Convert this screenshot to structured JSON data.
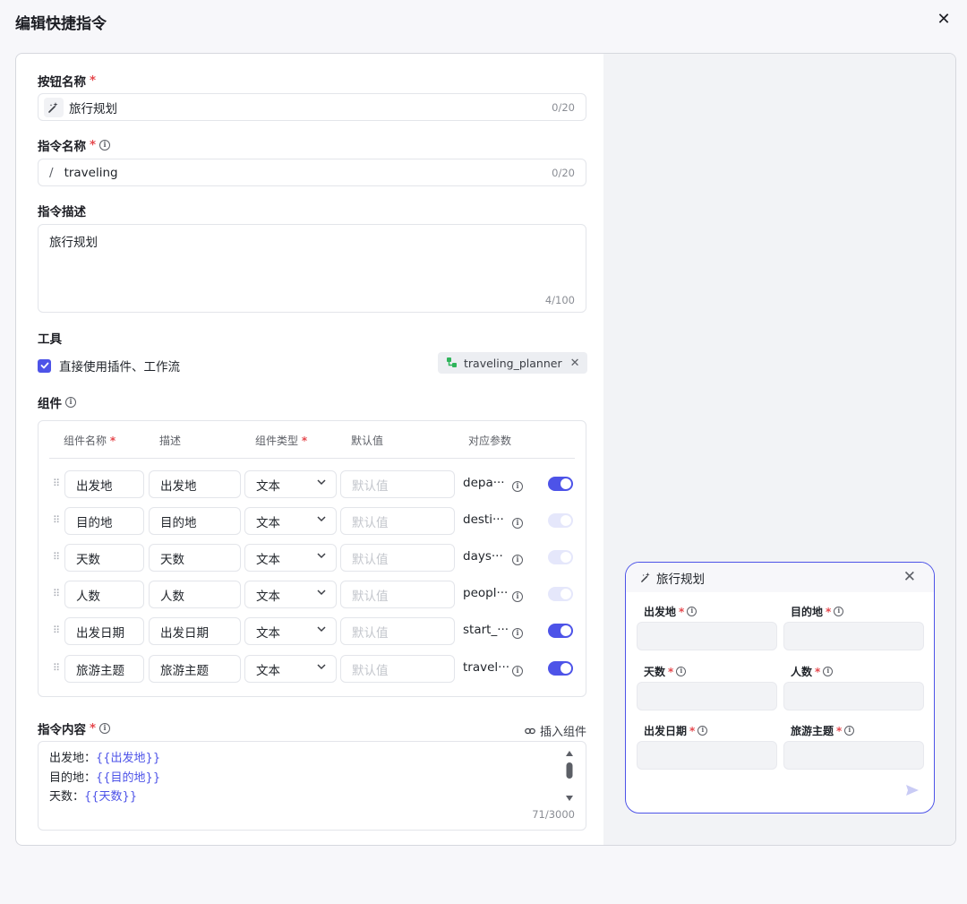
{
  "dialog": {
    "title": "编辑快捷指令"
  },
  "button_name": {
    "label": "按钮名称",
    "required": "*",
    "value": "旅行规划",
    "counter": "0/20"
  },
  "command_name": {
    "label": "指令名称",
    "required": "*",
    "prefix": "/",
    "value": "traveling",
    "counter": "0/20"
  },
  "command_desc": {
    "label": "指令描述",
    "value": "旅行规划",
    "counter": "4/100"
  },
  "tools": {
    "label": "工具",
    "checkbox_label": "直接使用插件、工作流",
    "checked": true,
    "tag": "traveling_planner"
  },
  "components": {
    "label": "组件",
    "headers": {
      "name": "组件名称",
      "desc": "描述",
      "type": "组件类型",
      "default": "默认值",
      "param": "对应参数",
      "required": "*"
    },
    "rows": [
      {
        "name": "出发地",
        "desc": "出发地",
        "type": "文本",
        "default_placeholder": "默认值",
        "param": "depa···",
        "enabled": true,
        "disabled": false
      },
      {
        "name": "目的地",
        "desc": "目的地",
        "type": "文本",
        "default_placeholder": "默认值",
        "param": "desti···",
        "enabled": true,
        "disabled": true
      },
      {
        "name": "天数",
        "desc": "天数",
        "type": "文本",
        "default_placeholder": "默认值",
        "param": "days···",
        "enabled": true,
        "disabled": true
      },
      {
        "name": "人数",
        "desc": "人数",
        "type": "文本",
        "default_placeholder": "默认值",
        "param": "peopl···",
        "enabled": true,
        "disabled": true
      },
      {
        "name": "出发日期",
        "desc": "出发日期",
        "type": "文本",
        "default_placeholder": "默认值",
        "param": "start_···",
        "enabled": true,
        "disabled": false
      },
      {
        "name": "旅游主题",
        "desc": "旅游主题",
        "type": "文本",
        "default_placeholder": "默认值",
        "param": "travel···",
        "enabled": true,
        "disabled": false
      }
    ]
  },
  "command_content": {
    "label": "指令内容",
    "required": "*",
    "insert_label": "插入组件",
    "lines": [
      {
        "key": "出发地：",
        "var": "{{出发地}}"
      },
      {
        "key": "目的地：",
        "var": "{{目的地}}"
      },
      {
        "key": "天数：",
        "var": "{{天数}}"
      }
    ],
    "counter": "71/3000"
  },
  "preview": {
    "title": "旅行规划",
    "fields": [
      {
        "label": "出发地",
        "required": "*"
      },
      {
        "label": "目的地",
        "required": "*"
      },
      {
        "label": "天数",
        "required": "*"
      },
      {
        "label": "人数",
        "required": "*"
      },
      {
        "label": "出发日期",
        "required": "*"
      },
      {
        "label": "旅游主题",
        "required": "*"
      }
    ]
  },
  "colors": {
    "accent": "#4d53e8",
    "required": "#e5484d",
    "toggle_disabled": "#e5e7fb"
  },
  "icons": [
    "magic-wand-icon",
    "info-icon",
    "close-icon",
    "check-icon",
    "workflow-icon",
    "drag-handle-icon",
    "chevron-down-icon",
    "link-icon",
    "send-icon"
  ]
}
